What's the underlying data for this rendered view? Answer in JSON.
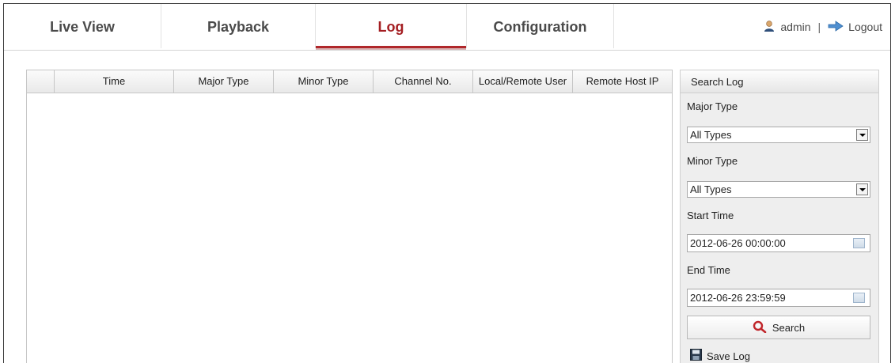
{
  "nav": {
    "tabs": [
      {
        "label": "Live View"
      },
      {
        "label": "Playback"
      },
      {
        "label": "Log"
      },
      {
        "label": "Configuration"
      }
    ],
    "active_tab": "Log",
    "user": "admin",
    "separator": "|",
    "logout_label": "Logout"
  },
  "table": {
    "columns": [
      "Time",
      "Major Type",
      "Minor Type",
      "Channel No.",
      "Local/Remote User",
      "Remote Host IP"
    ],
    "rows": []
  },
  "search_panel": {
    "title": "Search Log",
    "major_type_label": "Major Type",
    "major_type_value": "All Types",
    "minor_type_label": "Minor Type",
    "minor_type_value": "All Types",
    "start_time_label": "Start Time",
    "start_time_value": "2012-06-26 00:00:00",
    "end_time_label": "End Time",
    "end_time_value": "2012-06-26 23:59:59",
    "search_button": "Search",
    "save_log_label": "Save Log"
  },
  "colors": {
    "accent": "#a41e22",
    "tab_text": "#4a4a4a",
    "panel_bg": "#eeeeee"
  }
}
